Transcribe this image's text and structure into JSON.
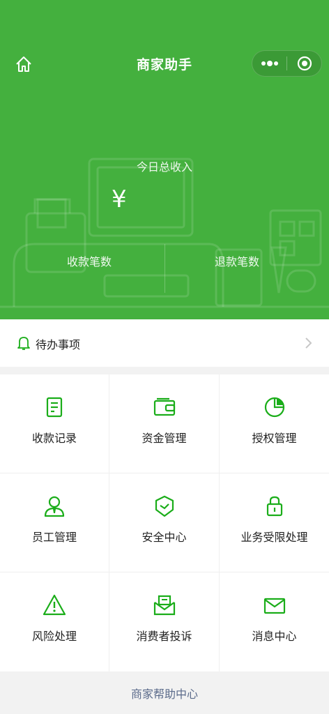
{
  "colors": {
    "brand_green": "#44b03e",
    "icon_green": "#1aad19",
    "link_blue": "#5a6a8a"
  },
  "nav": {
    "title": "商家助手",
    "home_icon": "home-icon",
    "more_icon": "more-dots-icon",
    "close_icon": "target-circle-icon"
  },
  "summary": {
    "income_label": "今日总收入",
    "income_value": "¥",
    "payments_label": "收款笔数",
    "refunds_label": "退款笔数"
  },
  "todo": {
    "label": "待办事项",
    "icon": "bell-icon"
  },
  "grid": [
    {
      "label": "收款记录",
      "icon": "document-icon"
    },
    {
      "label": "资金管理",
      "icon": "wallet-icon"
    },
    {
      "label": "授权管理",
      "icon": "pie-chart-icon"
    },
    {
      "label": "员工管理",
      "icon": "staff-icon"
    },
    {
      "label": "安全中心",
      "icon": "shield-icon"
    },
    {
      "label": "业务受限处理",
      "icon": "lock-icon"
    },
    {
      "label": "风险处理",
      "icon": "warning-icon"
    },
    {
      "label": "消费者投诉",
      "icon": "mail-open-icon"
    },
    {
      "label": "消息中心",
      "icon": "envelope-icon"
    }
  ],
  "footer": {
    "help_link": "商家帮助中心"
  }
}
